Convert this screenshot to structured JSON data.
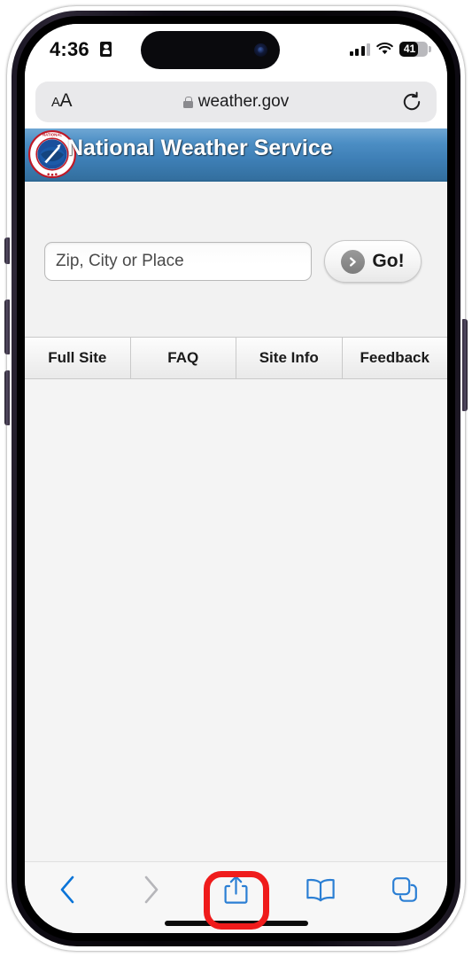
{
  "device": {
    "frame": "iphone-14-pro",
    "frame_color": "#2b2531"
  },
  "status_bar": {
    "time": "4:36",
    "location_icon": "location-arrow-icon",
    "signal_icon": "cellular-signal-icon",
    "wifi_icon": "wifi-icon",
    "battery_percent": "41",
    "battery_level": 41
  },
  "browser": {
    "name": "Safari",
    "text_size_button": "AA",
    "url": "weather.gov",
    "secure_icon": "lock-icon",
    "reload_icon": "reload-icon",
    "toolbar": [
      {
        "name": "back-button",
        "icon": "chevron-left-icon",
        "enabled": true,
        "color": "#0a74d8"
      },
      {
        "name": "forward-button",
        "icon": "chevron-right-icon",
        "enabled": false,
        "color": "#b6b6ba"
      },
      {
        "name": "share-button",
        "icon": "share-icon",
        "enabled": true,
        "color": "#2b7fd4",
        "highlighted": true
      },
      {
        "name": "bookmarks-button",
        "icon": "book-icon",
        "enabled": true,
        "color": "#2b7fd4"
      },
      {
        "name": "tabs-button",
        "icon": "tabs-icon",
        "enabled": true,
        "color": "#2b7fd4"
      }
    ],
    "highlight_color": "#ef1b1b"
  },
  "page": {
    "banner": {
      "title": "National Weather Service",
      "logo_icon": "noaa-nws-seal-icon",
      "bg_color_top": "#6fa7d4",
      "bg_color_bottom": "#336f9f"
    },
    "search": {
      "placeholder": "Zip, City or Place",
      "value": "",
      "go_label": "Go!",
      "go_icon": "arrow-right-circle-icon"
    },
    "nav_items": [
      {
        "label": "Full Site"
      },
      {
        "label": "FAQ"
      },
      {
        "label": "Site Info"
      },
      {
        "label": "Feedback"
      }
    ]
  }
}
